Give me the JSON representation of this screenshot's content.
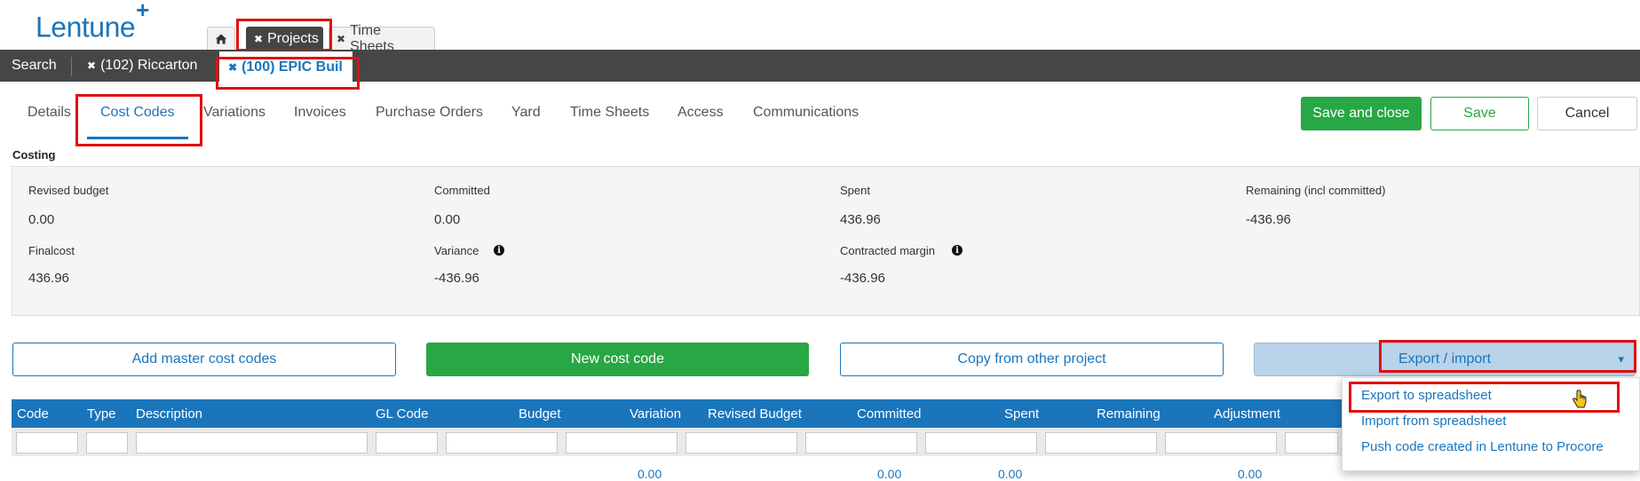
{
  "header": {
    "logo": "Lentune",
    "logo_plus": "+",
    "top_tabs": [
      {
        "label": "Projects",
        "close": "✖"
      },
      {
        "label": "Time Sheets",
        "close": "✖"
      }
    ],
    "home_icon": "home-icon"
  },
  "record_tabs": {
    "search": "Search",
    "items": [
      {
        "label": "(102) Riccarton",
        "close": "✖"
      },
      {
        "label": "(100) EPIC Buil",
        "close": "✖"
      }
    ]
  },
  "subnav": {
    "tabs": [
      "Details",
      "Cost Codes",
      "Variations",
      "Invoices",
      "Purchase Orders",
      "Yard",
      "Time Sheets",
      "Access",
      "Communications"
    ],
    "active": "Cost Codes"
  },
  "actions": {
    "save_close": "Save and close",
    "save": "Save",
    "cancel": "Cancel"
  },
  "costing": {
    "title": "Costing",
    "fields": [
      {
        "label": "Revised budget",
        "value": "0.00"
      },
      {
        "label": "Committed",
        "value": "0.00"
      },
      {
        "label": "Spent",
        "value": "436.96"
      },
      {
        "label": "Remaining (incl committed)",
        "value": "-436.96"
      },
      {
        "label": "Finalcost",
        "value": "436.96"
      },
      {
        "label": "Variance",
        "value": "-436.96"
      },
      {
        "label": "Contracted margin",
        "value": "-436.96"
      }
    ],
    "info_glyph": "i"
  },
  "toolbar": {
    "add_master": "Add master cost codes",
    "new_code": "New cost code",
    "copy": "Copy from other project",
    "export_import": "Export / import",
    "caret": "▾"
  },
  "export_menu": {
    "items": [
      "Export to spreadsheet",
      "Import from spreadsheet",
      "Push code created in Lentune to Procore"
    ]
  },
  "table": {
    "columns": [
      "Code",
      "Type",
      "Description",
      "GL Code",
      "Budget",
      "Variation",
      "Revised Budget",
      "Committed",
      "Spent",
      "Remaining",
      "Adjustment"
    ],
    "partial_values": [
      "0.00",
      "0.00",
      "0.00",
      "0.00"
    ]
  },
  "colors": {
    "brand_blue": "#1b75bb",
    "green": "#28a745",
    "dark_bar": "#464646",
    "highlight": "#e01010"
  }
}
